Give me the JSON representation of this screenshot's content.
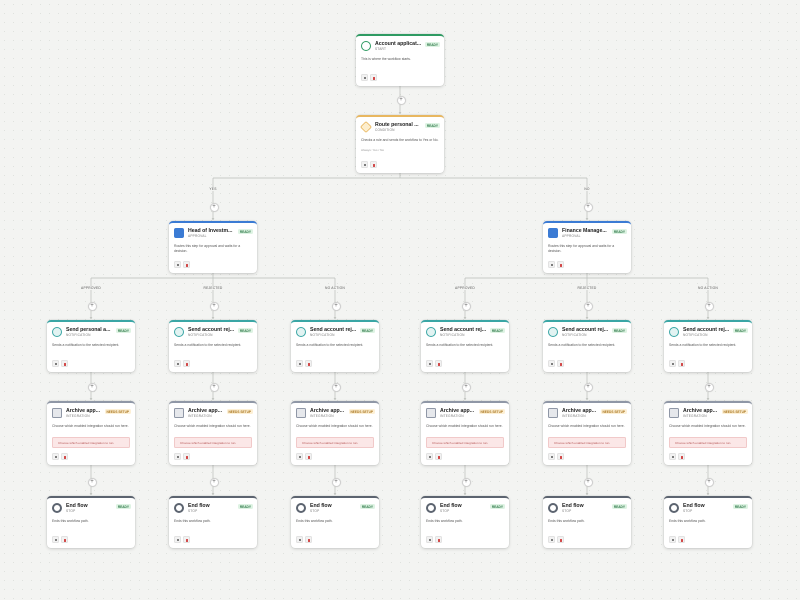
{
  "start": {
    "title": "Account applicat...",
    "type": "START",
    "badge": "READY",
    "desc": "This is where the workflow starts."
  },
  "condition": {
    "title": "Route personal ...",
    "type": "CONDITION",
    "badge": "READY",
    "desc": "Checks a rule and sends the workflow to Yes or No.",
    "extra": "Always: Yes / No"
  },
  "branch_labels": {
    "yes": "YES",
    "no": "NO"
  },
  "approvals": [
    {
      "title": "Head of Investm...",
      "type": "APPROVAL",
      "badge": "READY",
      "desc": "Routes this step for approval and waits for a decision."
    },
    {
      "title": "Finance Manage...",
      "type": "APPROVAL",
      "badge": "READY",
      "desc": "Routes this step for approval and waits for a decision."
    }
  ],
  "decision_labels": [
    "APPROVED",
    "REJECTED",
    "NO ACTION",
    "APPROVED",
    "REJECTED",
    "NO ACTION"
  ],
  "notifications": [
    {
      "title": "Send personal a...",
      "type": "NOTIFICATION",
      "badge": "READY",
      "desc": "Sends a notification to the selected recipient."
    },
    {
      "title": "Send account rej...",
      "type": "NOTIFICATION",
      "badge": "READY",
      "desc": "Sends a notification to the selected recipient."
    },
    {
      "title": "Send account rej...",
      "type": "NOTIFICATION",
      "badge": "READY",
      "desc": "Sends a notification to the selected recipient."
    },
    {
      "title": "Send account rej...",
      "type": "NOTIFICATION",
      "badge": "READY",
      "desc": "Sends a notification to the selected recipient."
    },
    {
      "title": "Send account rej...",
      "type": "NOTIFICATION",
      "badge": "READY",
      "desc": "Sends a notification to the selected recipient."
    },
    {
      "title": "Send account rej...",
      "type": "NOTIFICATION",
      "badge": "READY",
      "desc": "Sends a notification to the selected recipient."
    }
  ],
  "integration": {
    "title": "Archive app...",
    "type": "INTEGRATION",
    "badge": "NEEDS SETUP",
    "desc": "Choose which enabled integration should run here.",
    "error": "Choose which enabled integration to run."
  },
  "end": {
    "title": "End flow",
    "type": "STOP",
    "badge": "READY",
    "desc": "Ends this workflow path."
  },
  "colors": {
    "start": "#2f9b63",
    "condition": "#e8b760",
    "approval": "#3b7bd4",
    "notification": "#3aa6a5",
    "integration": "#8f97a6",
    "stop": "#5c6470"
  }
}
